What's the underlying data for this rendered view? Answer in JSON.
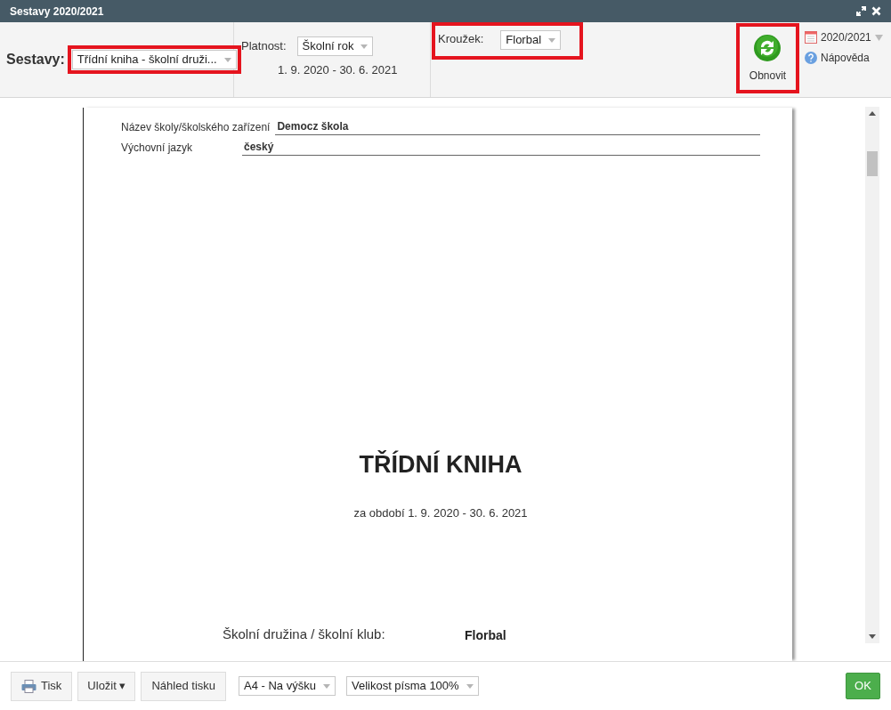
{
  "window": {
    "title": "Sestavy 2020/2021"
  },
  "toolbar": {
    "sestavy": {
      "label": "Sestavy:",
      "value": "Třídní kniha - školní druži...",
      "highlighted": true
    },
    "platnost": {
      "label": "Platnost:",
      "value": "Školní rok",
      "range": "1. 9. 2020 - 30. 6. 2021"
    },
    "krouzek": {
      "label": "Kroužek:",
      "value": "Florbal",
      "highlighted": true
    },
    "refresh": {
      "label": "Obnovit",
      "highlighted": true
    },
    "year": "2020/2021",
    "help": "Nápověda"
  },
  "document": {
    "fields": [
      {
        "label": "Název školy/školského zařízení",
        "value": "Democz škola"
      },
      {
        "label": "Výchovní jazyk",
        "value": "český"
      }
    ],
    "title": "TŘÍDNÍ KNIHA",
    "subtitle": "za období 1. 9. 2020 - 30. 6. 2021",
    "club": {
      "label": "Školní družina / školní klub:",
      "value": "Florbal"
    }
  },
  "footer": {
    "print": "Tisk",
    "save": "Uložit ▾",
    "preview": "Náhled tisku",
    "paper": "A4 - Na výšku",
    "font_size": "Velikost písma 100%",
    "ok": "OK"
  }
}
